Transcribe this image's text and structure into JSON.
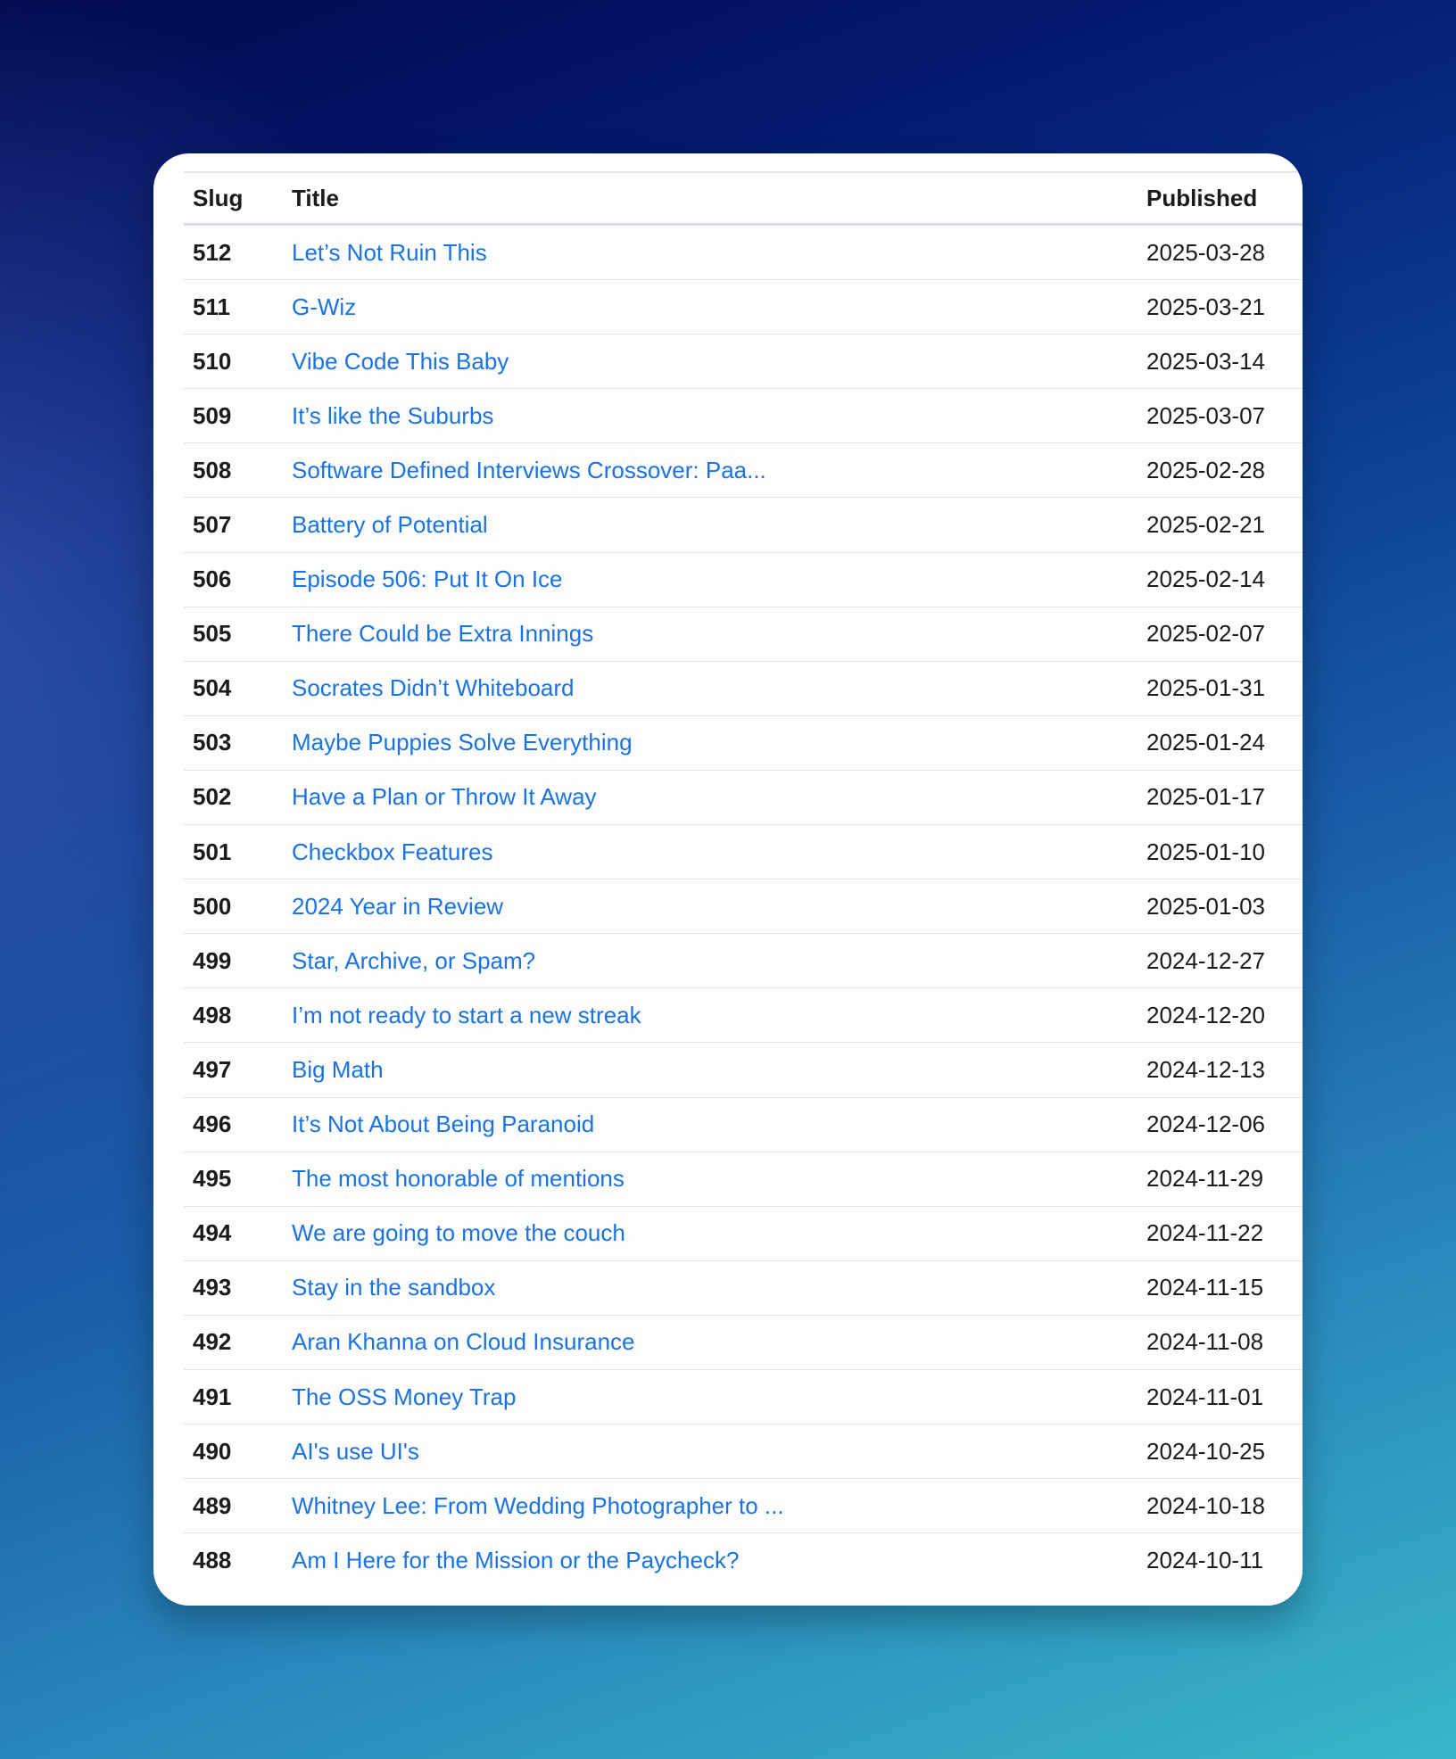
{
  "colors": {
    "link": "#1a73e0",
    "text": "#1b1b1f",
    "card_bg": "#fdfdfd"
  },
  "table": {
    "headers": {
      "slug": "Slug",
      "title": "Title",
      "published": "Published"
    },
    "rows": [
      {
        "slug": "512",
        "title": "Let’s Not Ruin This",
        "published": "2025-03-28"
      },
      {
        "slug": "511",
        "title": "G-Wiz",
        "published": "2025-03-21"
      },
      {
        "slug": "510",
        "title": "Vibe Code This Baby",
        "published": "2025-03-14"
      },
      {
        "slug": "509",
        "title": "It’s like the Suburbs",
        "published": "2025-03-07"
      },
      {
        "slug": "508",
        "title": "Software Defined Interviews Crossover: Paa...",
        "published": "2025-02-28"
      },
      {
        "slug": "507",
        "title": "Battery of Potential",
        "published": "2025-02-21"
      },
      {
        "slug": "506",
        "title": "Episode 506: Put It On Ice",
        "published": "2025-02-14"
      },
      {
        "slug": "505",
        "title": "There Could be Extra Innings",
        "published": "2025-02-07"
      },
      {
        "slug": "504",
        "title": "Socrates Didn’t Whiteboard",
        "published": "2025-01-31"
      },
      {
        "slug": "503",
        "title": "Maybe Puppies Solve Everything",
        "published": "2025-01-24"
      },
      {
        "slug": "502",
        "title": "Have a Plan or Throw It Away",
        "published": "2025-01-17"
      },
      {
        "slug": "501",
        "title": "Checkbox Features",
        "published": "2025-01-10"
      },
      {
        "slug": "500",
        "title": "2024 Year in Review",
        "published": "2025-01-03"
      },
      {
        "slug": "499",
        "title": "Star, Archive, or Spam?",
        "published": "2024-12-27"
      },
      {
        "slug": "498",
        "title": "I’m not ready to start a new streak",
        "published": "2024-12-20"
      },
      {
        "slug": "497",
        "title": "Big Math",
        "published": "2024-12-13"
      },
      {
        "slug": "496",
        "title": "It’s Not About Being Paranoid",
        "published": "2024-12-06"
      },
      {
        "slug": "495",
        "title": "The most honorable of mentions",
        "published": "2024-11-29"
      },
      {
        "slug": "494",
        "title": "We are going to move the couch",
        "published": "2024-11-22"
      },
      {
        "slug": "493",
        "title": "Stay in the sandbox",
        "published": "2024-11-15"
      },
      {
        "slug": "492",
        "title": "Aran Khanna on Cloud Insurance",
        "published": "2024-11-08"
      },
      {
        "slug": "491",
        "title": "The OSS Money Trap",
        "published": "2024-11-01"
      },
      {
        "slug": "490",
        "title": "AI's use UI's",
        "published": "2024-10-25"
      },
      {
        "slug": "489",
        "title": "Whitney Lee: From Wedding Photographer to ...",
        "published": "2024-10-18"
      },
      {
        "slug": "488",
        "title": "Am I Here for the Mission or the Paycheck?",
        "published": "2024-10-11"
      }
    ]
  }
}
